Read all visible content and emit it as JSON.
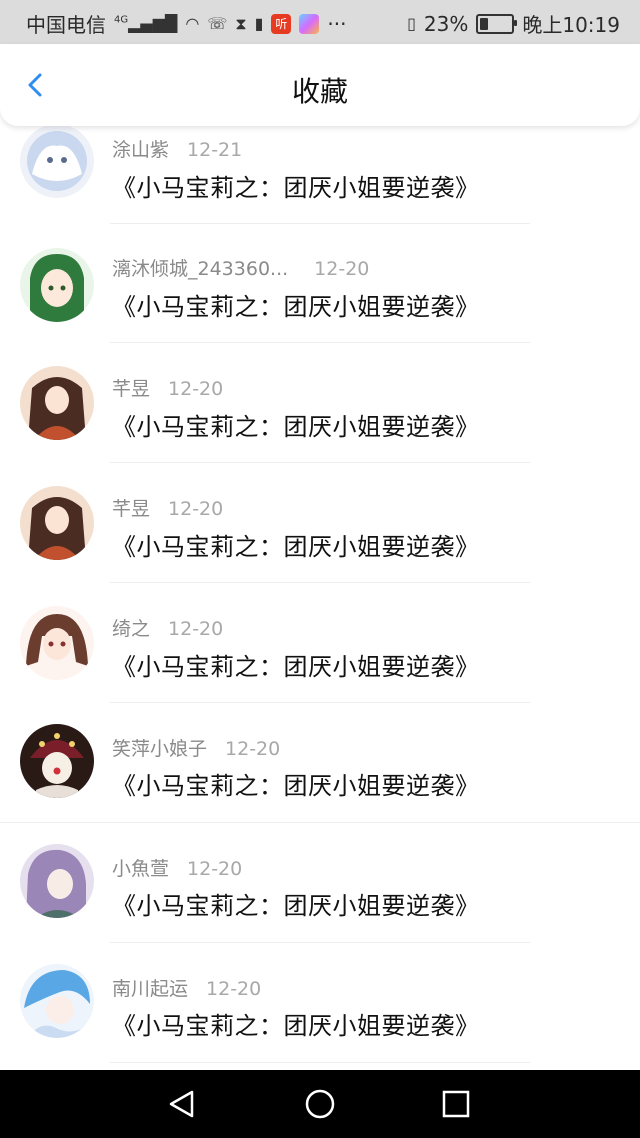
{
  "status_bar": {
    "carrier": "中国电信",
    "network": "4G",
    "battery_percent": "23%",
    "battery_level": 0.23,
    "time": "晚上10:19",
    "app_badge_1": "听",
    "app_badge_2": "",
    "more": "···"
  },
  "header": {
    "title": "收藏"
  },
  "favorites": [
    {
      "author": "涂山紫",
      "date": "12-21",
      "subject": "《小马宝莉之：团厌小姐要逆袭》"
    },
    {
      "author": "漓沐倾城_243360...",
      "date": "12-20",
      "subject": "《小马宝莉之：团厌小姐要逆袭》"
    },
    {
      "author": "芊昱",
      "date": "12-20",
      "subject": "《小马宝莉之：团厌小姐要逆袭》"
    },
    {
      "author": "芊昱",
      "date": "12-20",
      "subject": "《小马宝莉之：团厌小姐要逆袭》"
    },
    {
      "author": "绮之",
      "date": "12-20",
      "subject": "《小马宝莉之：团厌小姐要逆袭》"
    },
    {
      "author": "笑萍小娘子",
      "date": "12-20",
      "subject": "《小马宝莉之：团厌小姐要逆袭》"
    },
    {
      "author": "小魚萱",
      "date": "12-20",
      "subject": "《小马宝莉之：团厌小姐要逆袭》"
    },
    {
      "author": "南川起运",
      "date": "12-20",
      "subject": "《小马宝莉之：团厌小姐要逆袭》"
    }
  ],
  "colors": {
    "accent": "#2f8cf0",
    "status_bar_bg": "#dcdcdc",
    "nav_bar_bg": "#000000"
  },
  "icons": {
    "back": "chevron-left-icon",
    "nav_back": "triangle-back-icon",
    "nav_home": "circle-home-icon",
    "nav_recent": "square-recent-icon"
  }
}
